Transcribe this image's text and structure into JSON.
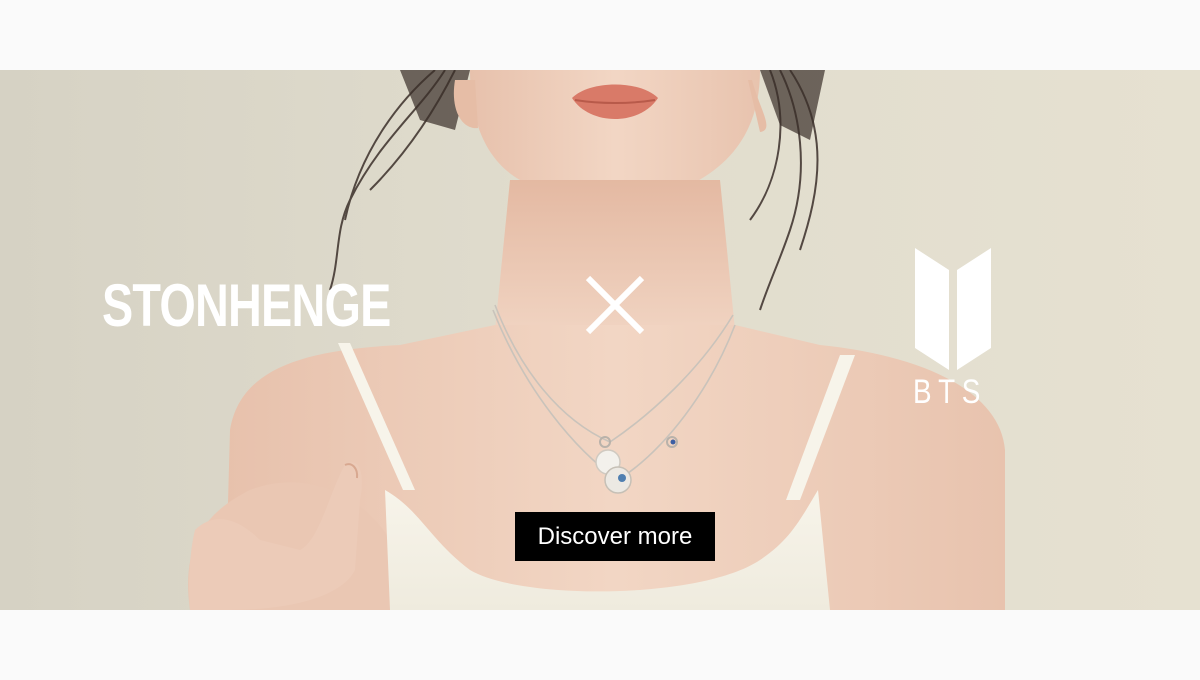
{
  "banner": {
    "brand_left": "STONHENGE",
    "cross_icon": "cross-icon",
    "brand_right_logo": "bts-logo-icon",
    "brand_right_text": "BTS",
    "cta_label": "Discover more"
  },
  "colors": {
    "page_background": "#fafafa",
    "banner_background": "#e0dccd",
    "skin": "#efd0bd",
    "cta_background": "#000000",
    "text_light": "#ffffff"
  }
}
